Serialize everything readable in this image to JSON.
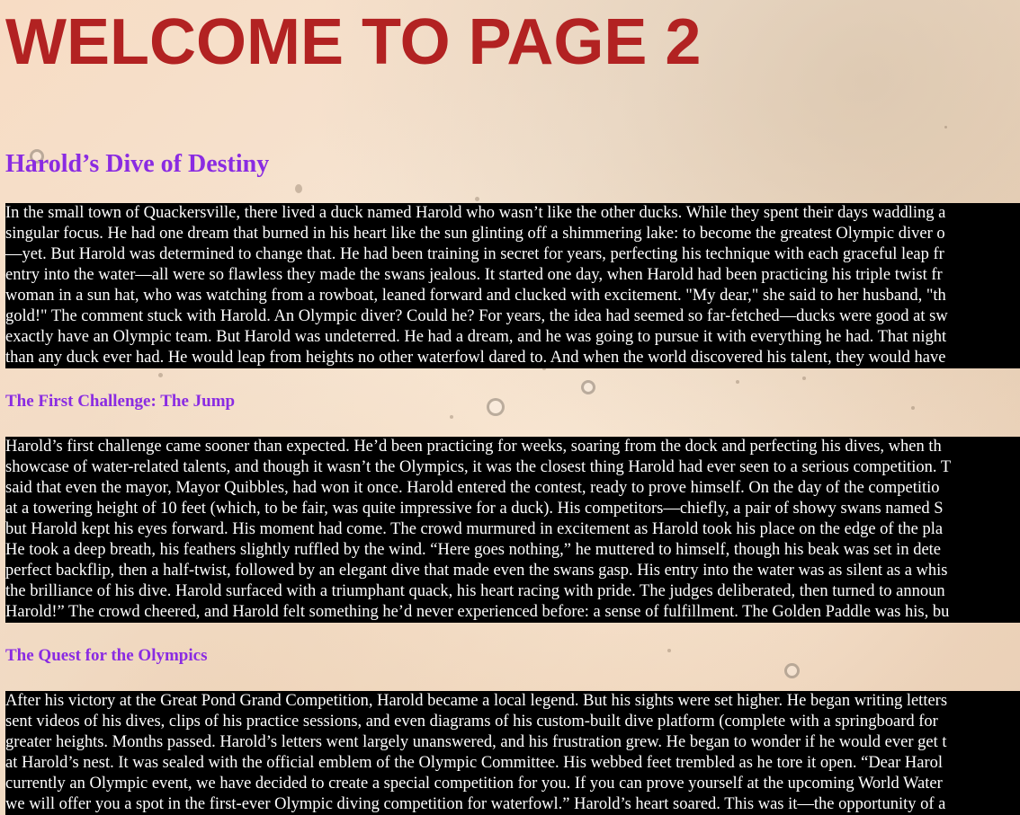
{
  "page_title": "WELCOME TO PAGE 2",
  "story_title": "Harold’s Dive of Destiny",
  "intro_lines": [
    "In the small town of Quackersville, there lived a duck named Harold who wasn’t like the other ducks. While they spent their days waddling a",
    "singular focus. He had one dream that burned in his heart like the sun glinting off a shimmering lake: to become the greatest Olympic diver o",
    "—yet. But Harold was determined to change that. He had been training in secret for years, perfecting his technique with each graceful leap fr",
    "entry into the water—all were so flawless they made the swans jealous. It started one day, when Harold had been practicing his triple twist fr",
    "woman in a sun hat, who was watching from a rowboat, leaned forward and clucked with excitement. \"My dear,\" she said to her husband, \"th",
    "gold!\" The comment stuck with Harold. An Olympic diver? Could he? For years, the idea had seemed so far-fetched—ducks were good at sw",
    "exactly have an Olympic team. But Harold was undeterred. He had a dream, and he was going to pursue it with everything he had. That night",
    "than any duck ever had. He would leap from heights no other waterfowl dared to. And when the world discovered his talent, they would have"
  ],
  "section1_heading": "The First Challenge: The Jump",
  "section1_lines": [
    "Harold’s first challenge came sooner than expected. He’d been practicing for weeks, soaring from the dock and perfecting his dives, when th",
    "showcase of water-related talents, and though it wasn’t the Olympics, it was the closest thing Harold had ever seen to a serious competition. T",
    "said that even the mayor, Mayor Quibbles, had won it once. Harold entered the contest, ready to prove himself. On the day of the competitio",
    "at a towering height of 10 feet (which, to be fair, was quite impressive for a duck). His competitors—chiefly, a pair of showy swans named S",
    "but Harold kept his eyes forward. His moment had come. The crowd murmured in excitement as Harold took his place on the edge of the pla",
    "He took a deep breath, his feathers slightly ruffled by the wind. “Here goes nothing,” he muttered to himself, though his beak was set in dete",
    "perfect backflip, then a half-twist, followed by an elegant dive that made even the swans gasp. His entry into the water was as silent as a whis",
    "the brilliance of his dive. Harold surfaced with a triumphant quack, his heart racing with pride. The judges deliberated, then turned to announ",
    "Harold!” The crowd cheered, and Harold felt something he’d never experienced before: a sense of fulfillment. The Golden Paddle was his, bu"
  ],
  "section2_heading": "The Quest for the Olympics",
  "section2_lines": [
    "After his victory at the Great Pond Grand Competition, Harold became a local legend. But his sights were set higher. He began writing letters",
    "sent videos of his dives, clips of his practice sessions, and even diagrams of his custom-built dive platform (complete with a springboard for",
    "greater heights. Months passed. Harold’s letters went largely unanswered, and his frustration grew. He began to wonder if he would ever get t",
    "at Harold’s nest. It was sealed with the official emblem of the Olympic Committee. His webbed feet trembled as he tore it open. “Dear Harol",
    "currently an Olympic event, we have decided to create a special competition for you. If you can prove yourself at the upcoming World Water",
    "we will offer you a spot in the first-ever Olympic diving competition for waterfowl.” Harold’s heart soared. This was it—the opportunity of a"
  ]
}
